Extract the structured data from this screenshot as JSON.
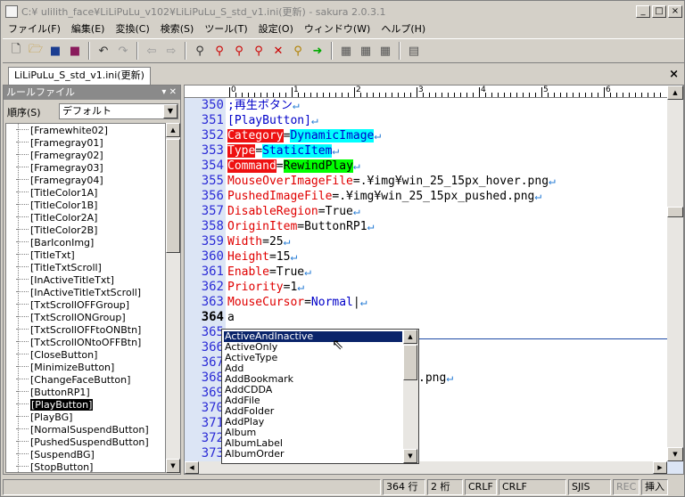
{
  "window": {
    "title": "C:¥ ulilith_face¥LiLiPuLu_v102¥LiLiPuLu_S_std_v1.ini(更新) - sakura 2.0.3.1",
    "min_label": "_",
    "max_label": "□",
    "close_label": "×"
  },
  "menu": [
    "ファイル(F)",
    "編集(E)",
    "変換(C)",
    "検索(S)",
    "ツール(T)",
    "設定(O)",
    "ウィンドウ(W)",
    "ヘルプ(H)"
  ],
  "tab": {
    "label": "LiLiPuLu_S_std_v1.ini(更新)",
    "close": "×"
  },
  "rule_panel": {
    "title": "ルールファイル",
    "order_label": "順序(S)",
    "order_value": "デフォルト",
    "items": [
      "[Framewhite02]",
      "[Framegray01]",
      "[Framegray02]",
      "[Framegray03]",
      "[Framegray04]",
      "[TitleColor1A]",
      "[TitleColor1B]",
      "[TitleColor2A]",
      "[TitleColor2B]",
      "[BarIconImg]",
      "[TitleTxt]",
      "[TitleTxtScroll]",
      "[InActiveTitleTxt]",
      "[InActiveTitleTxtScroll]",
      "[TxtScrollOFFGroup]",
      "[TxtScrollONGroup]",
      "[TxtScrollOFFtoONBtn]",
      "[TxtScrollONtoOFFBtn]",
      "[CloseButton]",
      "[MinimizeButton]",
      "[ChangeFaceButton]",
      "[ButtonRP1]",
      "[PlayButton]",
      "[PlayBG]",
      "[NormalSuspendButton]",
      "[PushedSuspendButton]",
      "[SuspendBG]",
      "[StopButton]"
    ],
    "selected_index": 22
  },
  "editor": {
    "ruler_marks": [
      "0",
      "1",
      "2",
      "3",
      "4",
      "5",
      "6"
    ],
    "line_numbers": [
      "350",
      "351",
      "352",
      "353",
      "354",
      "355",
      "356",
      "357",
      "358",
      "359",
      "360",
      "361",
      "362",
      "363",
      "364",
      "365",
      "366",
      "367",
      "368",
      "369",
      "370",
      "371",
      "372",
      "373"
    ],
    "current_line": "364",
    "lines": {
      "l350": ";再生ボタン",
      "l351": "[PlayButton]",
      "l352k": "Category",
      "l352v": "DynamicImage",
      "l353k": "Type",
      "l353v": "StaticItem",
      "l354k": "Command",
      "l354v": "RewindPlay",
      "l355k": "MouseOverImageFile",
      "l355v": ".¥img¥win_25_15px_hover.png",
      "l356k": "PushedImageFile",
      "l356v": ".¥img¥win_25_15px_pushed.png",
      "l357k": "DisableRegion",
      "l357v": "True",
      "l358k": "OriginItem",
      "l358v": "ButtonRP1",
      "l359k": "Width",
      "l359v": "25",
      "l360k": "Height",
      "l360v": "15",
      "l361k": "Enable",
      "l361v": "True",
      "l362k": "Priority",
      "l362v": "1",
      "l363k": "MouseCursor",
      "l363v": "Normal",
      "l364": "a",
      "l368tail": ".png"
    },
    "ret": "↵"
  },
  "autocomplete": [
    "ActiveAndInactive",
    "ActiveOnly",
    "ActiveType",
    "Add",
    "AddBookmark",
    "AddCDDA",
    "AddFile",
    "AddFolder",
    "AddPlay",
    "Album",
    "AlbumLabel",
    "AlbumOrder"
  ],
  "status": {
    "line": "364 行",
    "col": "2 桁",
    "eol1": "CRLF",
    "eol2": "CRLF",
    "encoding": "SJIS",
    "rec": "REC",
    "mode": "挿入"
  }
}
